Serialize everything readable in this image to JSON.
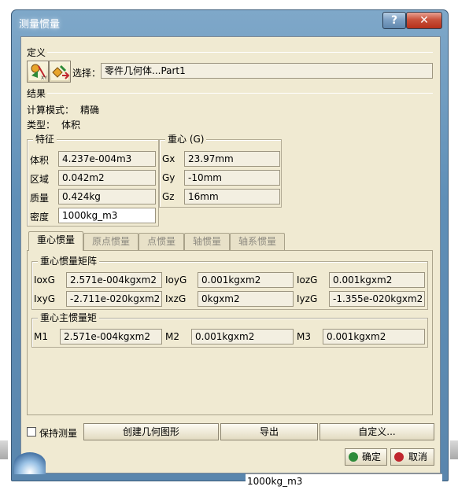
{
  "window": {
    "title": "测量惯量",
    "help": "?",
    "close": "✕"
  },
  "definition": {
    "label": "定义",
    "select_label": "选择：",
    "select_value": "零件几何体...Part1"
  },
  "results": {
    "label": "结果",
    "calc_mode_label": "计算模式：",
    "calc_mode_value": "精确",
    "type_label": "类型：",
    "type_value": "体积"
  },
  "features": {
    "title": "特征",
    "rows": [
      {
        "label": "体积",
        "value": "4.237e-004m3"
      },
      {
        "label": "区域",
        "value": "0.042m2"
      },
      {
        "label": "质量",
        "value": "0.424kg"
      },
      {
        "label": "密度",
        "value": "1000kg_m3"
      }
    ]
  },
  "center": {
    "title": "重心 (G)",
    "rows": [
      {
        "label": "Gx",
        "value": "23.97mm"
      },
      {
        "label": "Gy",
        "value": "-10mm"
      },
      {
        "label": "Gz",
        "value": "16mm"
      }
    ]
  },
  "tabs": [
    "重心惯量",
    "原点惯量",
    "点惯量",
    "轴惯量",
    "轴系惯量"
  ],
  "matrix": {
    "title": "重心惯量矩阵",
    "row1": [
      {
        "label": "IoxG",
        "value": "2.571e-004kgxm2"
      },
      {
        "label": "IoyG",
        "value": "0.001kgxm2"
      },
      {
        "label": "IozG",
        "value": "0.001kgxm2"
      }
    ],
    "row2": [
      {
        "label": "IxyG",
        "value": "-2.711e-020kgxm2"
      },
      {
        "label": "IxzG",
        "value": "0kgxm2"
      },
      {
        "label": "IyzG",
        "value": "-1.355e-020kgxm2"
      }
    ]
  },
  "principal": {
    "title": "重心主惯量矩",
    "items": [
      {
        "label": "M1",
        "value": "2.571e-004kgxm2"
      },
      {
        "label": "M2",
        "value": "0.001kgxm2"
      },
      {
        "label": "M3",
        "value": "0.001kgxm2"
      }
    ]
  },
  "bottom": {
    "keep_label": "保持测量",
    "create_geometry": "创建几何图形",
    "export": "导出",
    "customize": "自定义...",
    "ok": "确定",
    "cancel": "取消"
  },
  "status_text": "1000kg_m3",
  "colors": {
    "dialog_bg": "#f0ead2",
    "title_bar": "#6f9ac0",
    "close_red": "#c9523b"
  }
}
